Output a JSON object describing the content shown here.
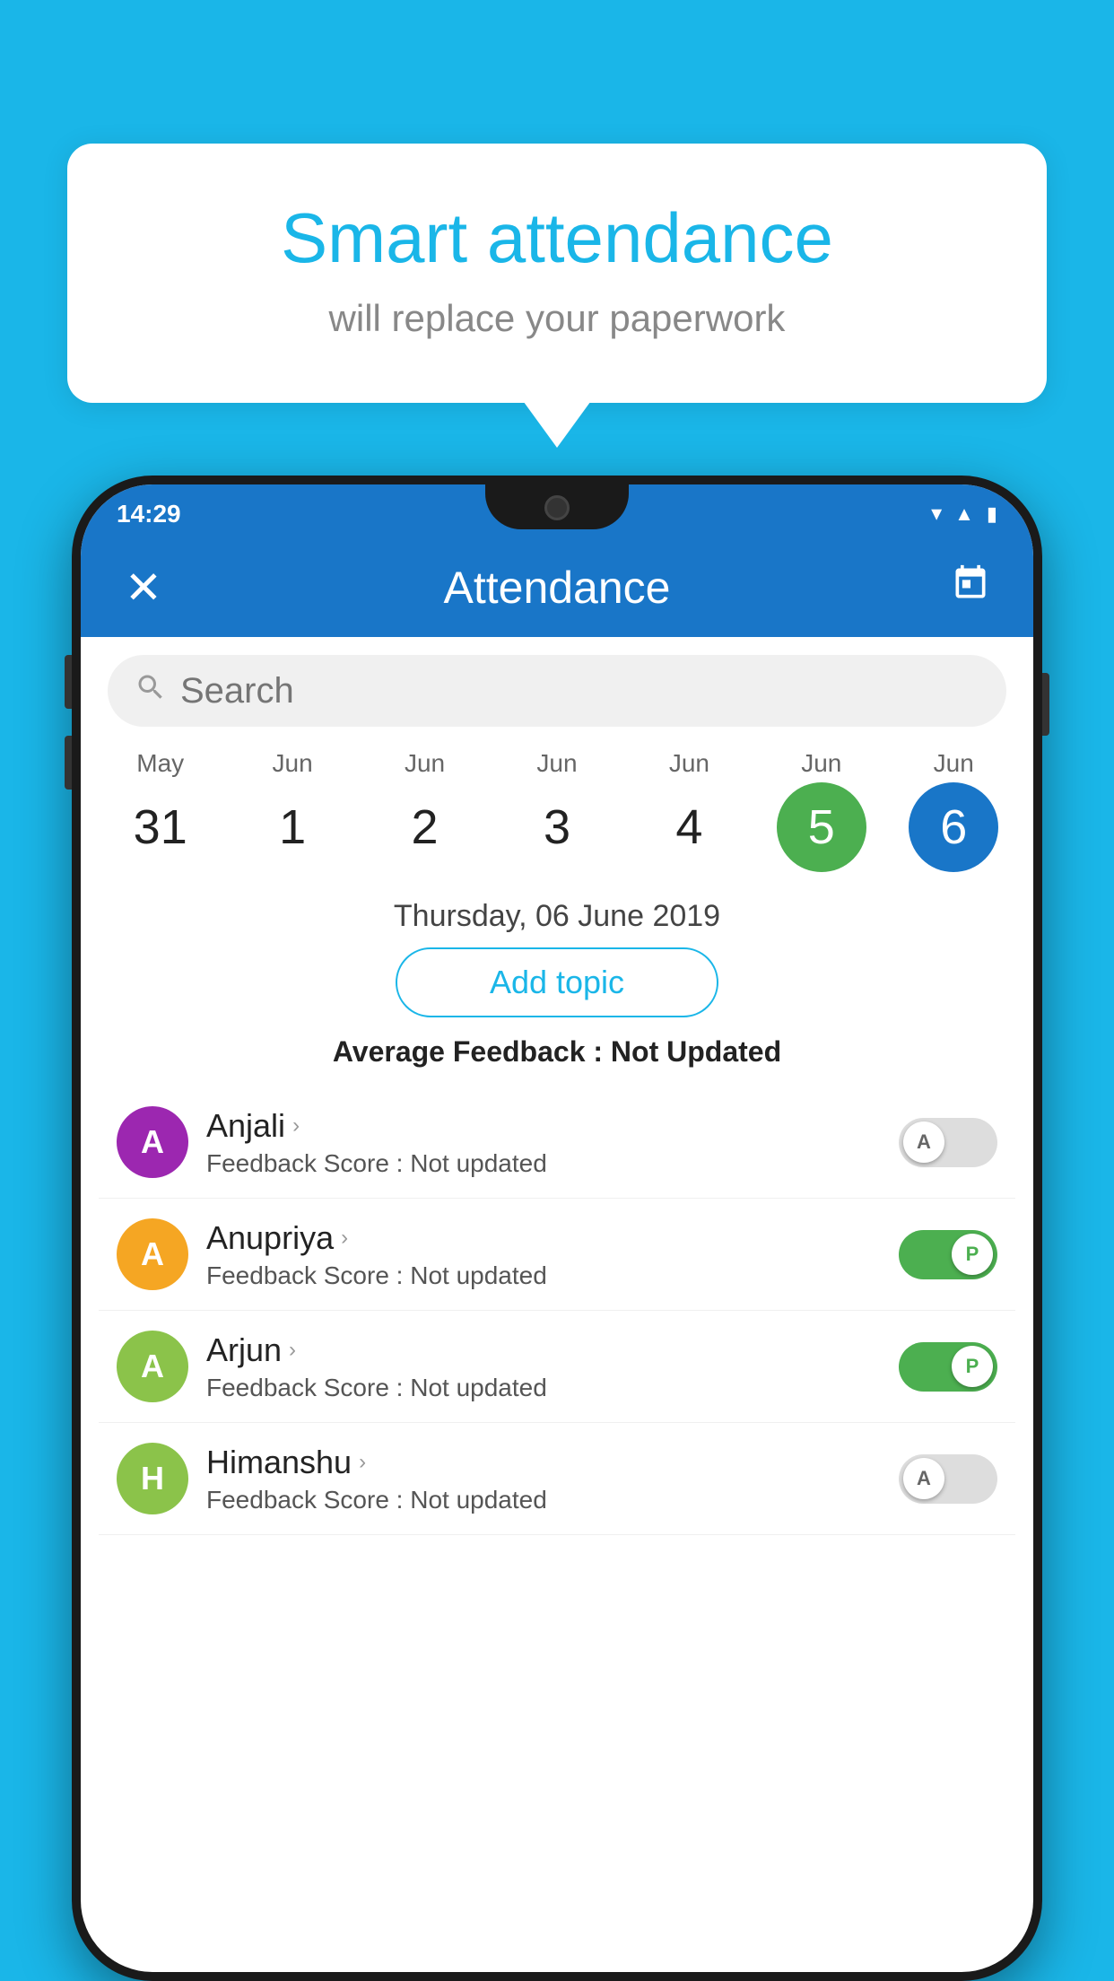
{
  "background_color": "#1ab6e8",
  "bubble": {
    "title": "Smart attendance",
    "subtitle": "will replace your paperwork"
  },
  "status_bar": {
    "time": "14:29",
    "icons": [
      "wifi",
      "signal",
      "battery"
    ]
  },
  "app_bar": {
    "close_label": "✕",
    "title": "Attendance",
    "calendar_label": "📅"
  },
  "search": {
    "placeholder": "Search"
  },
  "calendar": {
    "months": [
      "May",
      "Jun",
      "Jun",
      "Jun",
      "Jun",
      "Jun",
      "Jun"
    ],
    "dates": [
      "31",
      "1",
      "2",
      "3",
      "4",
      "5",
      "6"
    ],
    "today_index": 5,
    "selected_index": 6
  },
  "selected_date_label": "Thursday, 06 June 2019",
  "add_topic_label": "Add topic",
  "avg_feedback": {
    "label": "Average Feedback : ",
    "value": "Not Updated"
  },
  "students": [
    {
      "name": "Anjali",
      "avatar_letter": "A",
      "avatar_color": "#9c27b0",
      "feedback_label": "Feedback Score : ",
      "feedback_value": "Not updated",
      "toggle_state": "off",
      "toggle_letter": "A"
    },
    {
      "name": "Anupriya",
      "avatar_letter": "A",
      "avatar_color": "#f5a623",
      "feedback_label": "Feedback Score : ",
      "feedback_value": "Not updated",
      "toggle_state": "on",
      "toggle_letter": "P"
    },
    {
      "name": "Arjun",
      "avatar_letter": "A",
      "avatar_color": "#8bc34a",
      "feedback_label": "Feedback Score : ",
      "feedback_value": "Not updated",
      "toggle_state": "on",
      "toggle_letter": "P"
    },
    {
      "name": "Himanshu",
      "avatar_letter": "H",
      "avatar_color": "#8bc34a",
      "feedback_label": "Feedback Score : ",
      "feedback_value": "Not updated",
      "toggle_state": "off",
      "toggle_letter": "A"
    }
  ]
}
